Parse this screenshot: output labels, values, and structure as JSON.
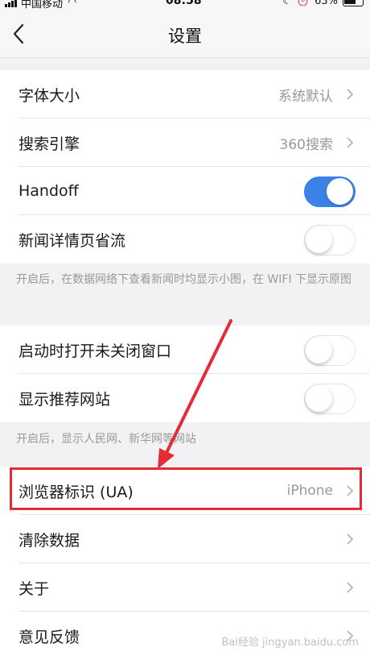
{
  "status_bar": {
    "carrier": "中国移动",
    "time": "08:58",
    "battery": "63%"
  },
  "nav": {
    "title": "设置"
  },
  "group1": {
    "font_size_label": "字体大小",
    "font_size_value": "系统默认",
    "search_engine_label": "搜索引擎",
    "search_engine_value": "360搜索",
    "handoff_label": "Handoff",
    "handoff_on": true,
    "news_saver_label": "新闻详情页省流",
    "news_saver_on": false
  },
  "note1": "开启后，在数据网络下查看新闻时均显示小图，在 WIFI 下显示原图",
  "group2": {
    "restore_windows_label": "启动时打开未关闭窗口",
    "restore_windows_on": false,
    "recommended_sites_label": "显示推荐网站",
    "recommended_sites_on": false
  },
  "note2": "开启后，显示人民网、新华网等网站",
  "group3": {
    "ua_label": "浏览器标识 (UA)",
    "ua_value": "iPhone",
    "clear_data_label": "清除数据",
    "about_label": "关于",
    "feedback_label": "意见反馈"
  },
  "colors": {
    "accent": "#3b82e6",
    "highlight": "#e42c37"
  },
  "watermark": "Bai经验 jingyan.baidu.com"
}
